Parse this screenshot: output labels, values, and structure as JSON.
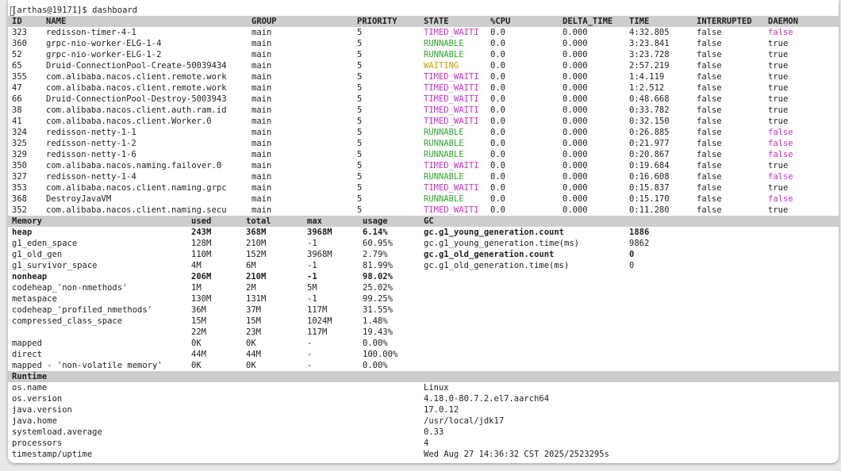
{
  "prompt": "[arthas@19171]$ dashboard",
  "colors": {
    "runnable": "#2fa52f",
    "timed_waiting": "#c233c2",
    "waiting": "#c9a100",
    "daemon_false": "#c233c2",
    "header_bg": "#cdcdcd"
  },
  "threads": {
    "headers": [
      "ID",
      "NAME",
      "GROUP",
      "PRIORITY",
      "STATE",
      "%CPU",
      "DELTA_TIME",
      "TIME",
      "INTERRUPTED",
      "DAEMON"
    ],
    "rows": [
      [
        "323",
        "redisson-timer-4-1",
        "main",
        "5",
        "TIMED_WAITI",
        "0.0",
        "0.000",
        "4:32.805",
        "false",
        "false"
      ],
      [
        "360",
        "grpc-nio-worker-ELG-1-4",
        "main",
        "5",
        "RUNNABLE",
        "0.0",
        "0.000",
        "3:23.841",
        "false",
        "true"
      ],
      [
        "52",
        "grpc-nio-worker-ELG-1-2",
        "main",
        "5",
        "RUNNABLE",
        "0.0",
        "0.000",
        "3:23.728",
        "false",
        "true"
      ],
      [
        "65",
        "Druid-ConnectionPool-Create-50039434",
        "main",
        "5",
        "WAITING",
        "0.0",
        "0.000",
        "2:57.219",
        "false",
        "true"
      ],
      [
        "355",
        "com.alibaba.nacos.client.remote.work",
        "main",
        "5",
        "TIMED_WAITI",
        "0.0",
        "0.000",
        "1:4.119",
        "false",
        "true"
      ],
      [
        "47",
        "com.alibaba.nacos.client.remote.work",
        "main",
        "5",
        "TIMED_WAITI",
        "0.0",
        "0.000",
        "1:2.512",
        "false",
        "true"
      ],
      [
        "66",
        "Druid-ConnectionPool-Destroy-5003943",
        "main",
        "5",
        "TIMED_WAITI",
        "0.0",
        "0.000",
        "0:48.668",
        "false",
        "true"
      ],
      [
        "38",
        "com.alibaba.nacos.client.auth.ram.id",
        "main",
        "5",
        "TIMED_WAITI",
        "0.0",
        "0.000",
        "0:33.782",
        "false",
        "true"
      ],
      [
        "41",
        "com.alibaba.nacos.client.Worker.0",
        "main",
        "5",
        "TIMED_WAITI",
        "0.0",
        "0.000",
        "0:32.150",
        "false",
        "true"
      ],
      [
        "324",
        "redisson-netty-1-1",
        "main",
        "5",
        "RUNNABLE",
        "0.0",
        "0.000",
        "0:26.885",
        "false",
        "false"
      ],
      [
        "325",
        "redisson-netty-1-2",
        "main",
        "5",
        "RUNNABLE",
        "0.0",
        "0.000",
        "0:21.977",
        "false",
        "false"
      ],
      [
        "329",
        "redisson-netty-1-6",
        "main",
        "5",
        "RUNNABLE",
        "0.0",
        "0.000",
        "0:20.867",
        "false",
        "false"
      ],
      [
        "350",
        "com.alibaba.nacos.naming.failover.0",
        "main",
        "5",
        "TIMED_WAITI",
        "0.0",
        "0.000",
        "0:19.684",
        "false",
        "true"
      ],
      [
        "327",
        "redisson-netty-1-4",
        "main",
        "5",
        "RUNNABLE",
        "0.0",
        "0.000",
        "0:16.608",
        "false",
        "false"
      ],
      [
        "353",
        "com.alibaba.nacos.client.naming.grpc",
        "main",
        "5",
        "TIMED_WAITI",
        "0.0",
        "0.000",
        "0:15.837",
        "false",
        "true"
      ],
      [
        "368",
        "DestroyJavaVM",
        "main",
        "5",
        "RUNNABLE",
        "0.0",
        "0.000",
        "0:15.170",
        "false",
        "false"
      ],
      [
        "352",
        "com.alibaba.nacos.client.naming.secu",
        "main",
        "5",
        "TIMED_WAITI",
        "0.0",
        "0.000",
        "0:11.280",
        "false",
        "true"
      ]
    ]
  },
  "memory": {
    "headers": [
      "Memory",
      "used",
      "total",
      "max",
      "usage"
    ],
    "rows": [
      {
        "cells": [
          "heap",
          "243M",
          "368M",
          "3968M",
          "6.14%"
        ],
        "bold": true
      },
      {
        "cells": [
          "g1_eden_space",
          "128M",
          "210M",
          "-1",
          "60.95%"
        ],
        "bold": false
      },
      {
        "cells": [
          "g1_old_gen",
          "110M",
          "152M",
          "3968M",
          "2.79%"
        ],
        "bold": false
      },
      {
        "cells": [
          "g1_survivor_space",
          "4M",
          "6M",
          "-1",
          "81.99%"
        ],
        "bold": false
      },
      {
        "cells": [
          "nonheap",
          "206M",
          "210M",
          "-1",
          "98.02%"
        ],
        "bold": true
      },
      {
        "cells": [
          "codeheap_'non-nmethods'",
          "1M",
          "2M",
          "5M",
          "25.02%"
        ],
        "bold": false
      },
      {
        "cells": [
          "metaspace",
          "130M",
          "131M",
          "-1",
          "99.25%"
        ],
        "bold": false
      },
      {
        "cells": [
          "codeheap_'profiled_nmethods'",
          "36M",
          "37M",
          "117M",
          "31.55%"
        ],
        "bold": false
      },
      {
        "cells": [
          "compressed_class_space",
          "15M",
          "15M",
          "1024M",
          "1.48%"
        ],
        "bold": false
      },
      {
        "cells": [
          "",
          "22M",
          "23M",
          "117M",
          "19.43%"
        ],
        "bold": false
      },
      {
        "cells": [
          "mapped",
          "0K",
          "0K",
          "-",
          "0.00%"
        ],
        "bold": false
      },
      {
        "cells": [
          "direct",
          "44M",
          "44M",
          "-",
          "100.00%"
        ],
        "bold": false
      },
      {
        "cells": [
          "mapped - 'non-volatile memory'",
          "0K",
          "0K",
          "-",
          "0.00%"
        ],
        "bold": false
      }
    ]
  },
  "gc": {
    "header": "GC",
    "rows": [
      {
        "key": "gc.g1_young_generation.count",
        "value": "1886",
        "bold": true
      },
      {
        "key": "gc.g1_young_generation.time(ms)",
        "value": "9862",
        "bold": false
      },
      {
        "key": "gc.g1_old_generation.count",
        "value": "0",
        "bold": true
      },
      {
        "key": "gc.g1_old_generation.time(ms)",
        "value": "0",
        "bold": false
      }
    ]
  },
  "runtime": {
    "header": "Runtime",
    "rows": [
      {
        "key": "os.name",
        "value": "Linux"
      },
      {
        "key": "os.version",
        "value": "4.18.0-80.7.2.el7.aarch64"
      },
      {
        "key": "java.version",
        "value": "17.0.12"
      },
      {
        "key": "java.home",
        "value": "/usr/local/jdk17"
      },
      {
        "key": "systemload.average",
        "value": "0.33"
      },
      {
        "key": "processors",
        "value": "4"
      },
      {
        "key": "timestamp/uptime",
        "value": "Wed Aug 27 14:36:32 CST 2025/2523295s"
      }
    ]
  }
}
